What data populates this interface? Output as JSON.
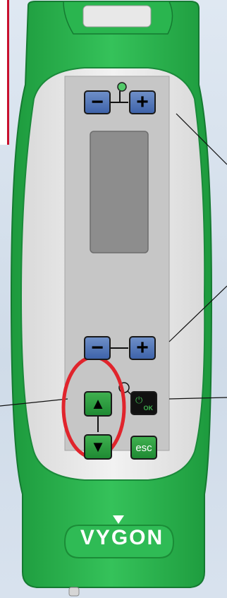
{
  "device": {
    "brand": "VYGON",
    "colors": {
      "body": "#27b04b",
      "body_dark": "#1b8c37",
      "panel": "#c9c9c9",
      "screen": "#8e8e8e",
      "highlight": "#e0242c"
    }
  },
  "buttons": {
    "top_minus": "−",
    "top_plus": "+",
    "mid_minus": "−",
    "mid_plus": "+",
    "up_arrow": "▲",
    "down_arrow": "▼",
    "power_icon": "⏻",
    "ok_label": "OK",
    "esc_label": "esc"
  },
  "icons": {
    "indicator_led": "led-indicator-icon",
    "power_ok": "power-ok-icon"
  }
}
